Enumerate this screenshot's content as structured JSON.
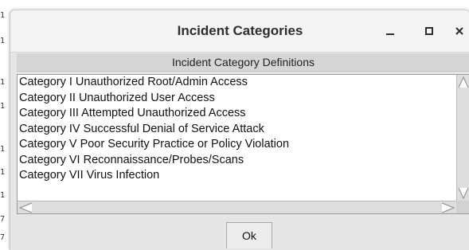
{
  "window": {
    "title": "Incident Categories",
    "controls": {
      "minimize_icon": "minimize-icon",
      "maximize_icon": "maximize-icon",
      "close_icon": "close-icon"
    }
  },
  "panel": {
    "header": "Incident Category Definitions"
  },
  "list": {
    "items": [
      "Category I Unauthorized Root/Admin Access",
      "Category II Unauthorized User Access",
      "Category III Attempted Unauthorized Access",
      "Category IV Successful Denial of Service Attack",
      "Category V Poor Security Practice or Policy Violation",
      "Category VI Reconnaissance/Probes/Scans",
      "Category VII Virus Infection"
    ]
  },
  "buttons": {
    "ok_label": "Ok"
  },
  "colors": {
    "dialog_bg": "#e6e6e6",
    "titlebar_bg": "#f4f4f4",
    "header_bg": "#d6d6d6",
    "list_bg": "#ffffff",
    "scrollbar_bg": "#dedede"
  }
}
